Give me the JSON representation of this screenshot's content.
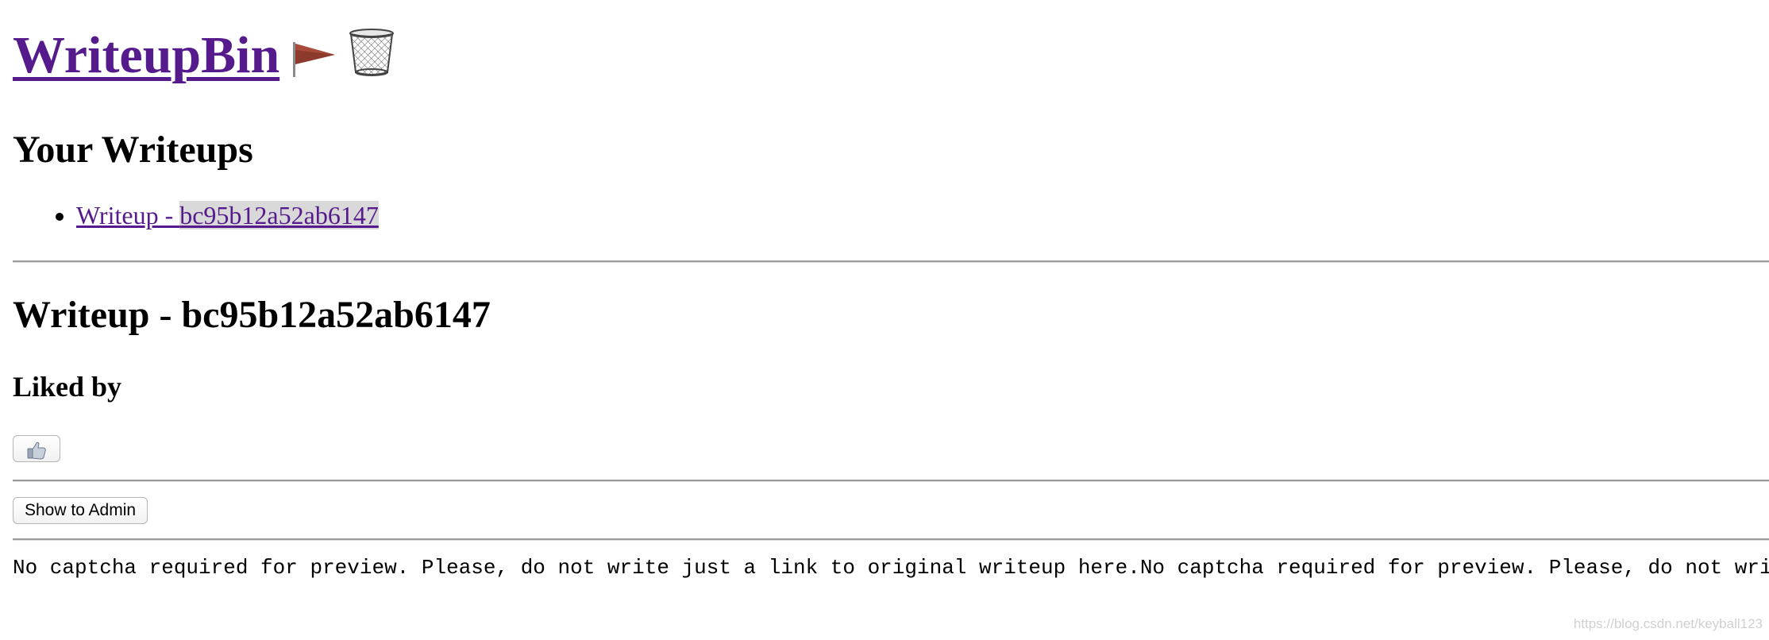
{
  "header": {
    "site_title": "WriteupBin"
  },
  "icons": {
    "title_emojis": [
      "triangular-flag-icon",
      "wastebasket-icon"
    ],
    "like": "thumbs-up-icon"
  },
  "your_writeups": {
    "heading": "Your Writeups",
    "items": [
      {
        "label_prefix": "Writeup - ",
        "label_id": "bc95b12a52ab6147"
      }
    ]
  },
  "writeup": {
    "title": "Writeup - bc95b12a52ab6147",
    "liked_by_heading": "Liked by",
    "show_admin_label": "Show to Admin",
    "content": "No captcha required for preview. Please, do not write just a link to original writeup here.No captcha required for preview. Please, do not wri"
  },
  "watermark": "https://blog.csdn.net/keyball123",
  "colors": {
    "link": "#551a8b",
    "rule": "#9a9a9a",
    "selection": "#d9d9d9"
  }
}
